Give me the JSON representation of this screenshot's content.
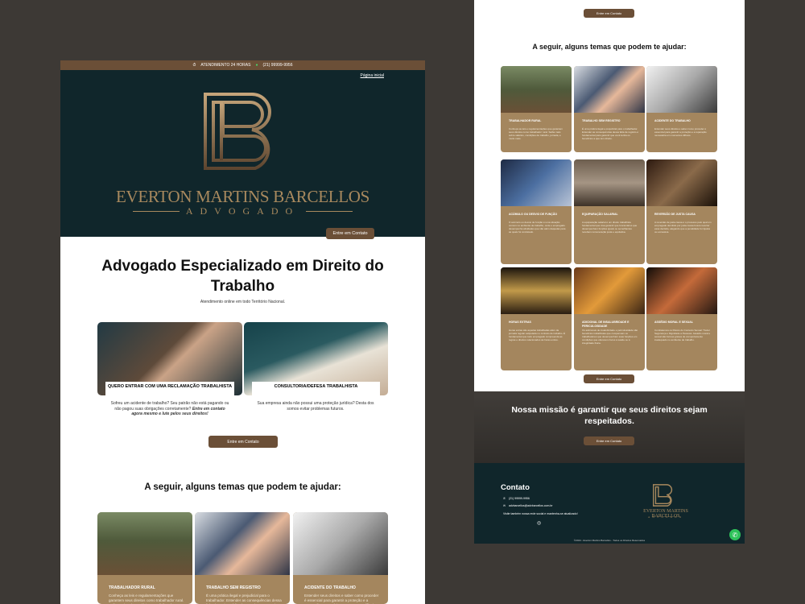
{
  "topbar": {
    "hours": "ATENDIMENTO 24 HORAS",
    "phone": "(21) 99999-9956"
  },
  "nav": {
    "home": "Página inicial"
  },
  "brand": {
    "name": "EVERTON MARTINS BARCELLOS",
    "role": "ADVOGADO"
  },
  "hero": {
    "cta": "Entre em Contato"
  },
  "intro": {
    "title": "Advogado Especializado em Direito do Trabalho",
    "subtitle": "Atendimento online em todo Território Nacional."
  },
  "services": [
    {
      "label": "QUERO ENTRAR COM UMA RECLAMAÇÃO TRABALHISTA",
      "text": "Sofreu um acidente de trabalho? Seu patrão não está pagando ou não pagou suas obrigações corretamente?",
      "emphasis": "Entre em contato agora mesmo e lute pelos seus direitos!"
    },
    {
      "label": "CONSULTORIA/DEFESA TRABALHISTA",
      "text": "Sua empresa ainda não possui uma proteção jurídica? Desta dos somos evitar problemas futuros."
    }
  ],
  "cta_main": "Entre em Contato",
  "topics_heading": "A seguir, alguns temas que podem te ajudar:",
  "topics": [
    {
      "title": "TRABALHADOR RURAL",
      "text": "Conheça as leis e regulamentações que garantem seus direitos como trabalhador rural. Saiba mais sobre salários, condições de trabalho, jornada, e muito mais."
    },
    {
      "title": "TRABALHO SEM REGISTRO",
      "text": "É uma prática ilegal e prejudicial para o trabalhador. Entender as consequências dessa falta de registro é fundamental para garantir que você tenha os benefícios a que tem direito."
    },
    {
      "title": "ACIDENTE DO TRABALHO",
      "text": "Entender seus direitos e saber como proceder é essencial para garantir a proteção e a reparação necessária em momentos difíceis."
    },
    {
      "title": "ACÚMULO OU DESVIO DE FUNÇÃO",
      "text": "O acúmulo ou desvio de função é uma situação comum no ambiente de trabalho, onde o empregado desempenha atividades que vão além daquelas para as quais foi contratado."
    },
    {
      "title": "EQUIPARAÇÃO SALARIAL",
      "text": "A equiparação salarial é um direito trabalhista fundamental que visa garantir que funcionários que desempenham funções iguais ou semelhantes recebam remuneração justa e equitativa."
    },
    {
      "title": "REVERSÃO DE JUSTA CAUSA",
      "text": "A reversão de justa causa é o processo pelo qual um empregado demitido por justa causa busca reverter essa decisão, alegando que a penalidade foi injusta ou excessiva."
    },
    {
      "title": "HORAS EXTRAS",
      "text": "Horas extras são aquelas trabalhadas além da jornada regular estipulada no contrato de trabalho. É fundamental que todo empregado compreenda as regras e direitos relacionados às horas extras."
    },
    {
      "title": "ADICIONAL DE INSALUBRIDADE E PERICULOSIDADE",
      "text": "Os adicionais de insalubridade e periculosidade são benefícios trabalhistas que compensam os trabalhadores que desempenham suas funções em condições que oferecem riscos à saúde ou à integridade física."
    },
    {
      "title": "ASSÉDIO MORAL E SEXUAL",
      "text": "Combatemos os Riscos do Contexto Sexual: Trazer Segurança e Dignidade a Pessoas. Assédio moral e sexual são formas graves de comportamento inadequado no ambiente de trabalho."
    }
  ],
  "mission": {
    "text": "Nossa missão é garantir que seus direitos sejam respeitados.",
    "cta": "Entre em Contato"
  },
  "contact": {
    "title": "Contato",
    "phone": "(21) 99999-9956",
    "email": "advbarcellos@advbarcellos.com.br",
    "note": "Visite também nossa rede social e mantenha-se atualizado!"
  },
  "footer": {
    "copyright": "©2024 - Everton Martins Barcellos - Todos os Direitos Reservados"
  },
  "colors": {
    "accent": "#6b4f37",
    "card": "#a4865e",
    "dark": "#10262b"
  }
}
